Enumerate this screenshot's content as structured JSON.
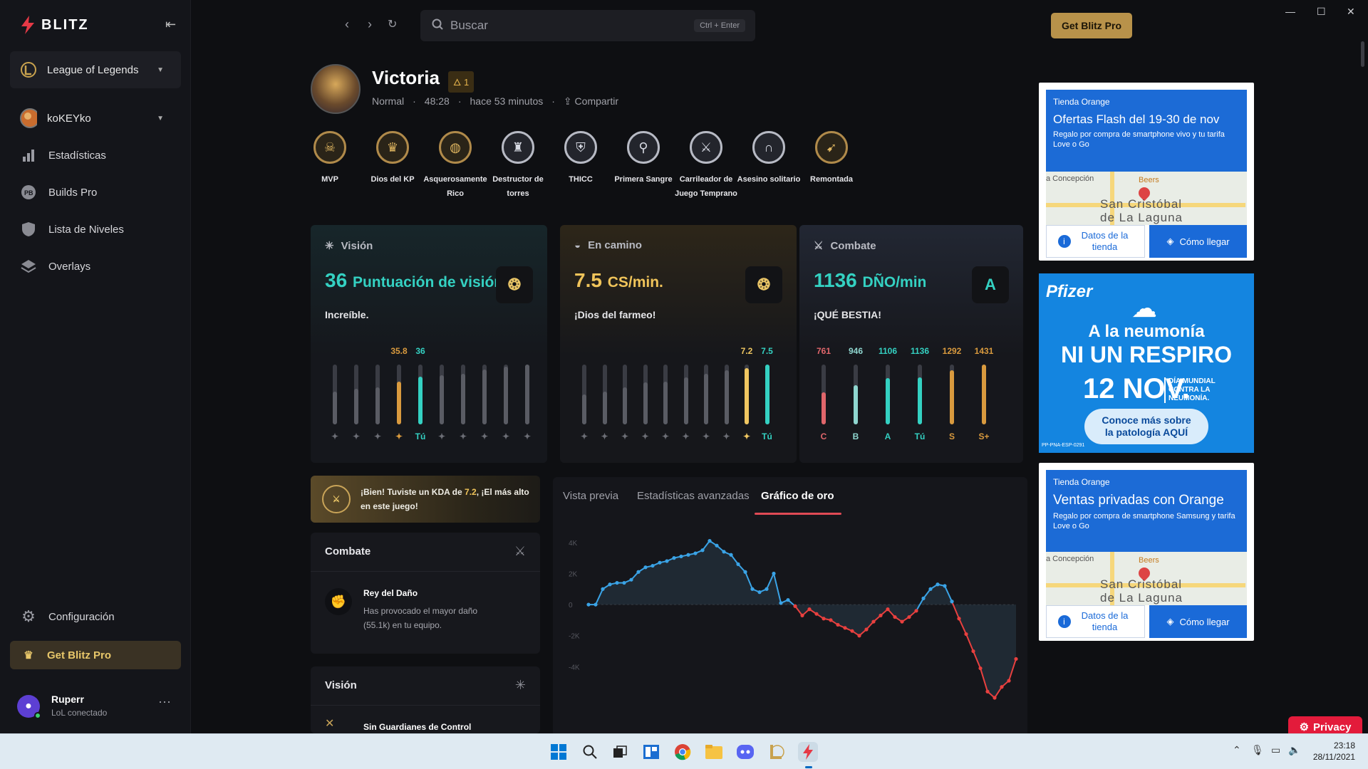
{
  "app": {
    "brand": "BLITZ",
    "get_pro_top": "Get Blitz Pro"
  },
  "sidebar": {
    "game": "League of Legends",
    "account": "koKEYko",
    "items": [
      {
        "label": "Estadísticas",
        "icon": "bar-chart-icon"
      },
      {
        "label": "Builds Pro",
        "icon": "pb-icon"
      },
      {
        "label": "Lista de Niveles",
        "icon": "shield-icon"
      },
      {
        "label": "Overlays",
        "icon": "layers-icon"
      }
    ],
    "settings": "Configuración",
    "get_pro": "Get Blitz Pro",
    "user": {
      "name": "Ruperr",
      "status": "LoL conectado"
    }
  },
  "search": {
    "placeholder": "Buscar",
    "shortcut": "Ctrl + Enter"
  },
  "match": {
    "player": "Victoria",
    "level": "1",
    "mode": "Normal",
    "duration": "48:28",
    "time_ago": "hace 53 minutos",
    "share": "Compartir"
  },
  "badges": [
    {
      "l1": "MVP",
      "l2": "",
      "icon": "mvp-icon"
    },
    {
      "l1": "Dios del KP",
      "l2": "",
      "icon": "crown-icon"
    },
    {
      "l1": "Asquerosamente",
      "l2": "Rico",
      "icon": "gold-bag-icon"
    },
    {
      "l1": "Destructor de",
      "l2": "torres",
      "icon": "tower-icon"
    },
    {
      "l1": "THICC",
      "l2": "",
      "icon": "shield-icon"
    },
    {
      "l1": "Primera Sangre",
      "l2": "",
      "icon": "blade-icon"
    },
    {
      "l1": "Carrileador de",
      "l2": "Juego Temprano",
      "icon": "sword-icon"
    },
    {
      "l1": "Asesino solitario",
      "l2": "",
      "icon": "arch-icon"
    },
    {
      "l1": "Remontada",
      "l2": "",
      "icon": "bow-icon"
    }
  ],
  "cards": {
    "vision": {
      "title": "Visión",
      "value": "36",
      "unit": "Puntuación de visión",
      "sub": "Increíble.",
      "bars": [
        {
          "val": "",
          "frac": 0.55,
          "lab": "✦",
          "color": "#5a5c64"
        },
        {
          "val": "",
          "frac": 0.6,
          "lab": "✦",
          "color": "#5a5c64"
        },
        {
          "val": "",
          "frac": 0.62,
          "lab": "✦",
          "color": "#5a5c64"
        },
        {
          "val": "35.8",
          "frac": 0.72,
          "lab": "✦",
          "color": "#d99a3e"
        },
        {
          "val": "36",
          "frac": 0.8,
          "lab": "Tú",
          "color": "#34d1c2"
        },
        {
          "val": "",
          "frac": 0.82,
          "lab": "✦",
          "color": "#5a5c64"
        },
        {
          "val": "",
          "frac": 0.85,
          "lab": "✦",
          "color": "#5a5c64"
        },
        {
          "val": "",
          "frac": 0.92,
          "lab": "✦",
          "color": "#5a5c64"
        },
        {
          "val": "",
          "frac": 0.96,
          "lab": "✦",
          "color": "#5a5c64"
        },
        {
          "val": "",
          "frac": 1.0,
          "lab": "✦",
          "color": "#5a5c64"
        }
      ]
    },
    "farm": {
      "title": "En camino",
      "value": "7.5",
      "unit": "CS/min.",
      "sub": "¡Dios del farmeo!",
      "bars": [
        {
          "val": "",
          "frac": 0.5,
          "lab": "✦",
          "color": "#5a5c64"
        },
        {
          "val": "",
          "frac": 0.55,
          "lab": "✦",
          "color": "#5a5c64"
        },
        {
          "val": "",
          "frac": 0.62,
          "lab": "✦",
          "color": "#5a5c64"
        },
        {
          "val": "",
          "frac": 0.7,
          "lab": "✦",
          "color": "#5a5c64"
        },
        {
          "val": "",
          "frac": 0.72,
          "lab": "✦",
          "color": "#5a5c64"
        },
        {
          "val": "",
          "frac": 0.78,
          "lab": "✦",
          "color": "#5a5c64"
        },
        {
          "val": "",
          "frac": 0.84,
          "lab": "✦",
          "color": "#5a5c64"
        },
        {
          "val": "",
          "frac": 0.9,
          "lab": "✦",
          "color": "#5a5c64"
        },
        {
          "val": "7.2",
          "frac": 0.94,
          "lab": "✦",
          "color": "#efc661"
        },
        {
          "val": "7.5",
          "frac": 1.0,
          "lab": "Tú",
          "color": "#34d1c2"
        }
      ]
    },
    "combat": {
      "title": "Combate",
      "value": "1136",
      "unit": "DÑO/min",
      "sub": "¡QUÉ BESTIA!",
      "grade": "A",
      "bars": [
        {
          "val": "761",
          "frac": 0.53,
          "lab": "C",
          "color": "#e0666b"
        },
        {
          "val": "946",
          "frac": 0.66,
          "lab": "B",
          "color": "#8fd6cf"
        },
        {
          "val": "1106",
          "frac": 0.77,
          "lab": "A",
          "color": "#34d1c2"
        },
        {
          "val": "1136",
          "frac": 0.79,
          "lab": "Tú",
          "color": "#34d1c2"
        },
        {
          "val": "1292",
          "frac": 0.9,
          "lab": "S",
          "color": "#d99a3e"
        },
        {
          "val": "1431",
          "frac": 1.0,
          "lab": "S+",
          "color": "#d99a3e"
        }
      ]
    }
  },
  "kda": {
    "pre": "¡Bien! Tuviste un KDA de ",
    "val": "7.2",
    "post": ", ¡El más alto en este juego!"
  },
  "combat_panel": {
    "title": "Combate",
    "item_title": "Rey del Daño",
    "item_desc1": "Has provocado el mayor daño",
    "item_desc2": "(55.1k) en tu equipo."
  },
  "vision_panel": {
    "title": "Visión",
    "item_title": "Sin Guardianes de Control"
  },
  "graph": {
    "tabs": [
      "Vista previa",
      "Estadísticas avanzadas",
      "Gráfico de oro"
    ],
    "ylabels": [
      "4K",
      "2K",
      "0",
      "-2K",
      "-4K"
    ],
    "gold": [
      0,
      0,
      1000,
      1300,
      1400,
      1400,
      1600,
      2100,
      2400,
      2500,
      2700,
      2800,
      3000,
      3100,
      3200,
      3300,
      3500,
      4100,
      3800,
      3400,
      3200,
      2600,
      2100,
      1000,
      800,
      1000,
      2000,
      100,
      300,
      -100,
      -700,
      -300,
      -600,
      -900,
      -1000,
      -1300,
      -1500,
      -1700,
      -2000,
      -1600,
      -1100,
      -700,
      -300,
      -800,
      -1100,
      -800,
      -400,
      400,
      1000,
      1300,
      1200,
      200,
      -900,
      -1900,
      -3000,
      -4100,
      -5600,
      -6000,
      -5300,
      -4900,
      -3500
    ]
  },
  "ads": [
    {
      "brand": "Tienda Orange",
      "title": "Ofertas Flash del 19-30 de nov",
      "desc": "Regalo por compra de smartphone vivo y tu tarifa Love o Go",
      "store": "Datos de la tienda",
      "directions": "Cómo llegar",
      "map1": "a Concepción",
      "map2": "San Cristóbal",
      "map3": "de La Laguna",
      "map4": "Beers"
    },
    {
      "brand": "Tienda Orange",
      "title": "Ventas privadas con Orange",
      "desc": "Regalo por compra de smartphone Samsung y tarifa Love o Go",
      "store": "Datos de la tienda",
      "directions": "Cómo llegar",
      "map1": "a Concepción",
      "map2": "San Cristóbal",
      "map3": "de La Laguna",
      "map4": "Beers"
    }
  ],
  "pfizer": {
    "logo": "Pfizer",
    "l1": "A la neumonía",
    "l2": "NI UN RESPIRO",
    "date": "12 NOV.",
    "dm1": "DÍA MUNDIAL",
    "dm2": "CONTRA LA",
    "dm3": "NEUMONÍA.",
    "cta1": "Conoce más sobre",
    "cta2": "la patología AQUÍ",
    "code": "PP-PNA-ESP-0291"
  },
  "privacy": "Privacy",
  "clock": {
    "time": "23:18",
    "date": "28/11/2021"
  }
}
